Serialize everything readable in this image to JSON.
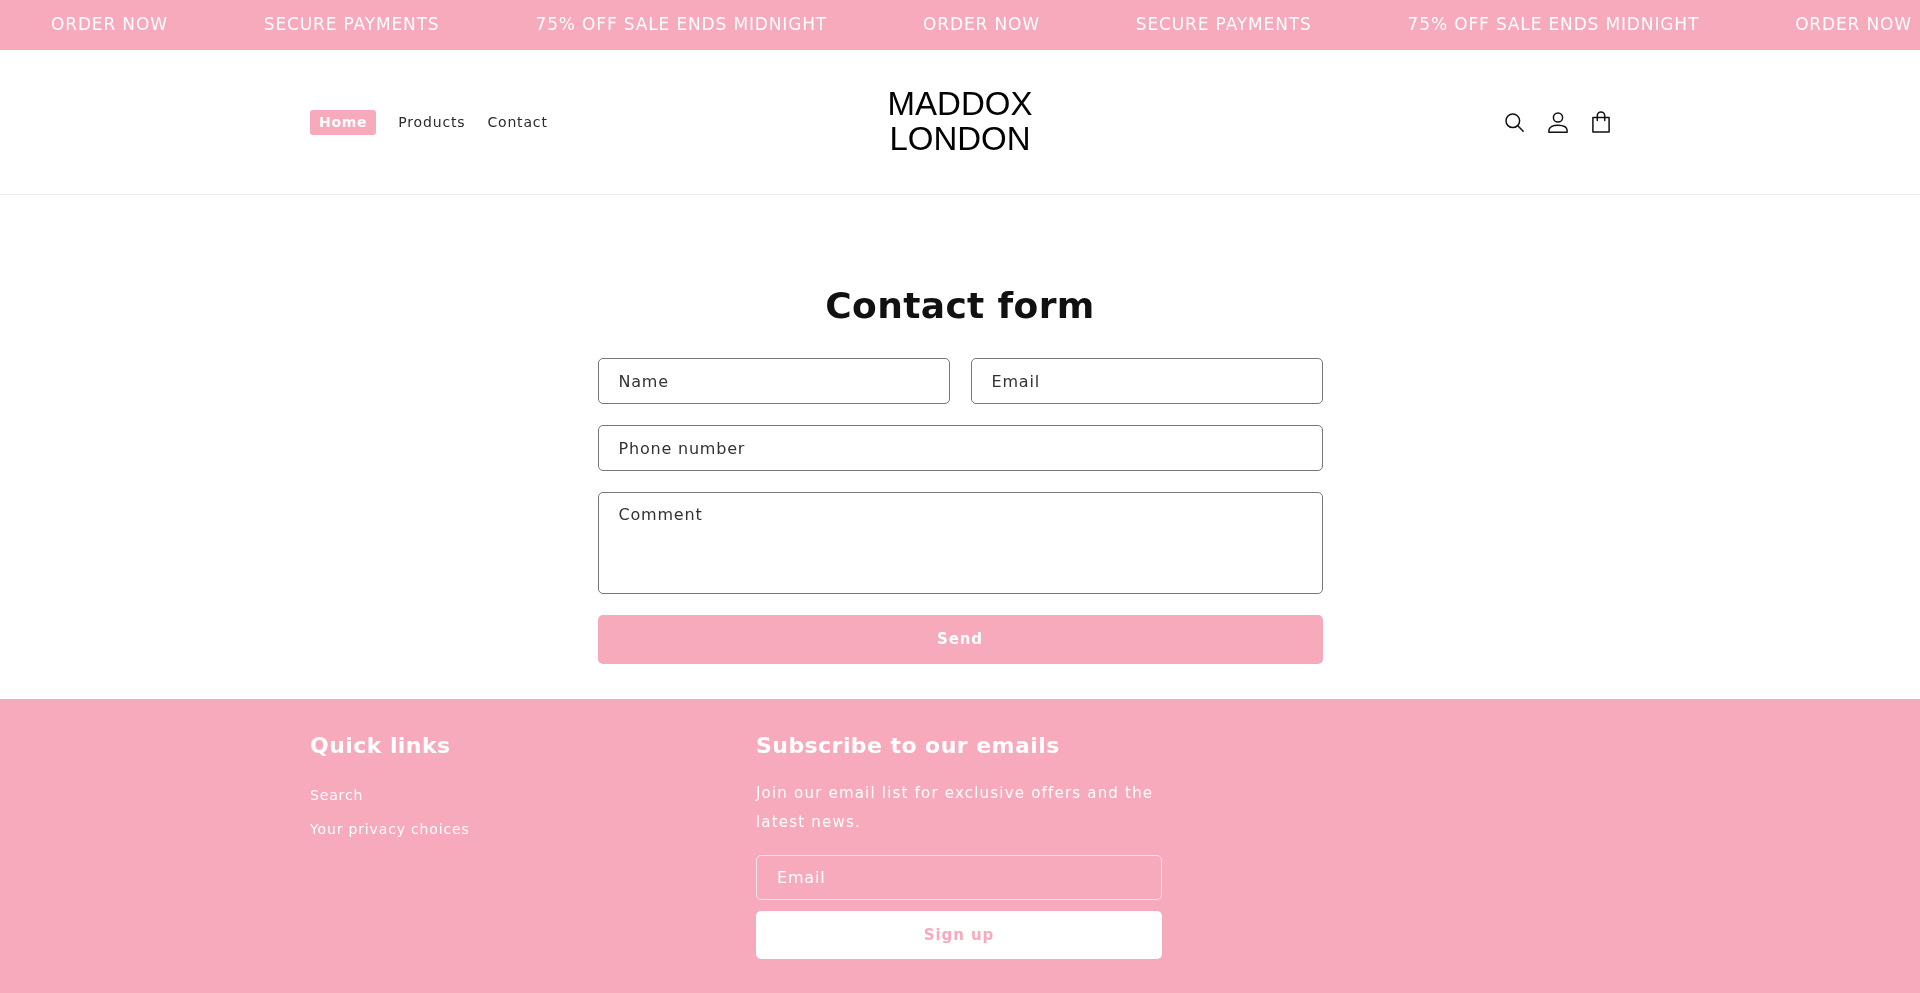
{
  "announcement_bar": {
    "items": [
      "ORDER NOW",
      "SECURE PAYMENTS",
      "75% OFF SALE ENDS MIDNIGHT",
      "ORDER NOW",
      "SECURE PAYMENTS",
      "75% OFF SALE ENDS MIDNIGHT",
      "ORDER NOW"
    ]
  },
  "header": {
    "nav": [
      {
        "label": "Home",
        "selected": true
      },
      {
        "label": "Products",
        "selected": false
      },
      {
        "label": "Contact",
        "selected": false
      }
    ],
    "logo": [
      "MADDOX",
      "LONDON"
    ]
  },
  "contact_form": {
    "title": "Contact form",
    "rows": [
      [
        {
          "kind": "input",
          "placeholder": "Name"
        },
        {
          "kind": "input",
          "placeholder": "Email"
        }
      ],
      [
        {
          "kind": "input",
          "placeholder": "Phone number"
        }
      ],
      [
        {
          "kind": "textarea",
          "placeholder": "Comment"
        }
      ]
    ],
    "submit": "Send"
  },
  "footer": {
    "quick_links": {
      "title": "Quick links",
      "links": [
        "Search",
        "Your privacy choices"
      ]
    },
    "newsletter": {
      "title": "Subscribe to our emails",
      "text": "Join our email list for exclusive offers and the latest news.",
      "email_placeholder": "Email",
      "button": "Sign up"
    }
  }
}
